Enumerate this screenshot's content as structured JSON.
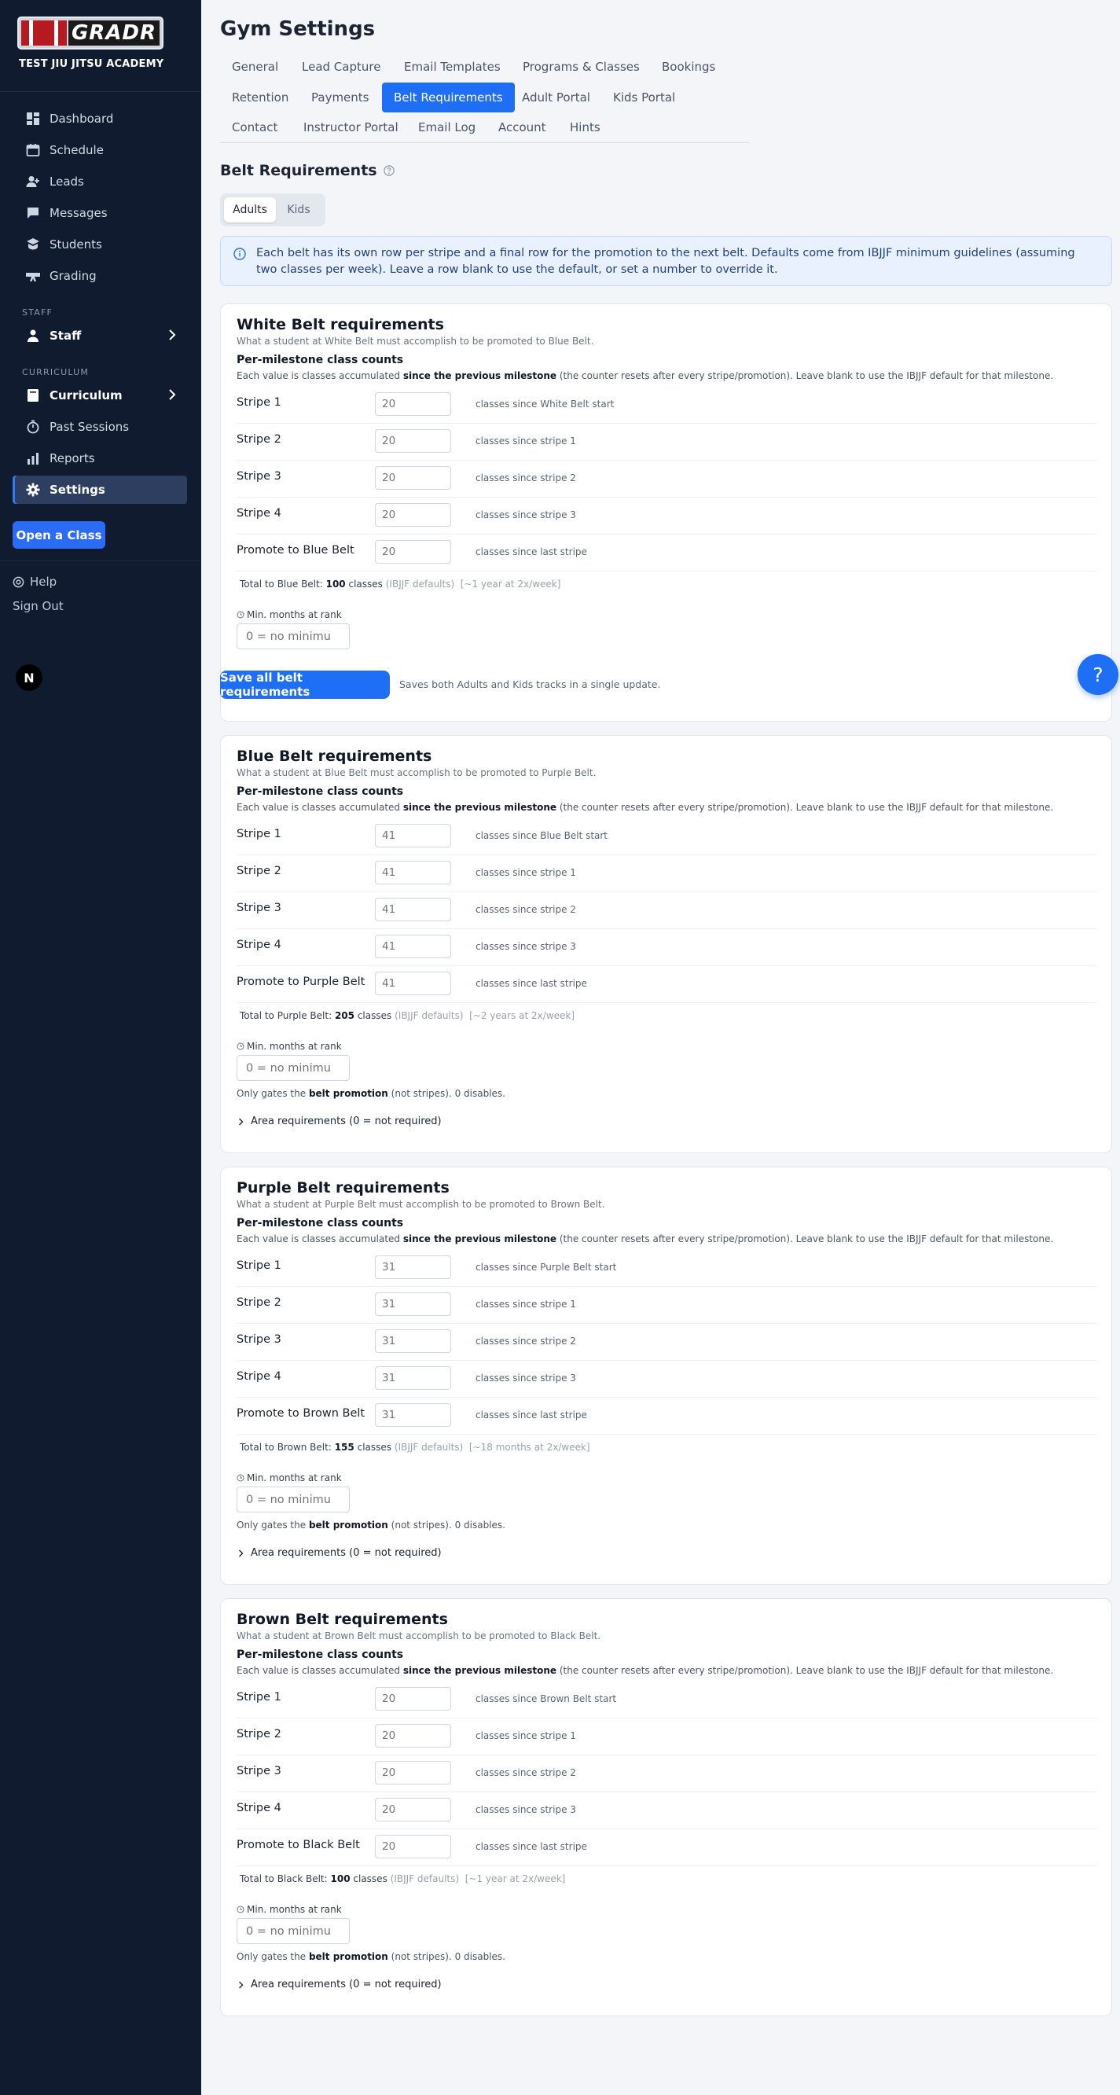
{
  "sidebar": {
    "logo_text": "GRADR",
    "academy": "TEST JIU JITSU ACADEMY",
    "nav": [
      {
        "label": "Dashboard",
        "icon": "dashboard-icon"
      },
      {
        "label": "Schedule",
        "icon": "calendar-icon"
      },
      {
        "label": "Leads",
        "icon": "user-plus-icon"
      },
      {
        "label": "Messages",
        "icon": "chat-icon"
      },
      {
        "label": "Students",
        "icon": "users-icon"
      },
      {
        "label": "Grading",
        "icon": "belt-icon"
      }
    ],
    "staff_section": "STAFF",
    "staff_item": "Staff",
    "curriculum_section": "CURRICULUM",
    "curriculum_nav": [
      {
        "label": "Curriculum",
        "icon": "book-icon"
      },
      {
        "label": "Past Sessions",
        "icon": "stopwatch-icon"
      },
      {
        "label": "Reports",
        "icon": "bar-chart-icon"
      },
      {
        "label": "Settings",
        "icon": "gear-icon"
      }
    ],
    "open_class": "Open a Class",
    "help": "Help",
    "sign_out": "Sign Out",
    "avatar": "N"
  },
  "header": {
    "title": "Gym Settings",
    "tabs": [
      "General",
      "Lead Capture",
      "Email Templates",
      "Programs & Classes",
      "Bookings",
      "Retention",
      "Payments",
      "Belt Requirements",
      "Adult Portal",
      "Kids Portal",
      "Contact",
      "Instructor Portal",
      "Email Log",
      "Account",
      "Hints"
    ],
    "active_tab": "Belt Requirements"
  },
  "section": {
    "title": "Belt Requirements",
    "segments": [
      "Adults",
      "Kids"
    ],
    "active_segment": "Adults",
    "info": "Each belt has its own row per stripe and a final row for the promotion to the next belt. Defaults come from IBJJF minimum guidelines (assuming two classes per week). Leave a row blank to use the default, or set a number to override it."
  },
  "common": {
    "pm_title": "Per-milestone class counts",
    "pm_desc_pre": "Each value is classes accumulated ",
    "pm_desc_bold": "since the previous milestone",
    "pm_desc_post": " (the counter resets after every stripe/promotion). Leave blank to use the IBJJF default for that milestone.",
    "stripe_labels": [
      "Stripe 1",
      "Stripe 2",
      "Stripe 3",
      "Stripe 4"
    ],
    "stripe_hints": [
      "classes since stripe 1",
      "classes since stripe 2",
      "classes since stripe 3"
    ],
    "last_hint": "classes since last stripe",
    "min_months_label": "Min. months at rank",
    "min_months_placeholder": "0 = no minimu",
    "gates_pre": "Only gates the ",
    "gates_bold": "belt promotion",
    "gates_post": " (not stripes). 0 disables.",
    "area_label": "Area requirements (0 = not required)",
    "classes_word": "classes",
    "ibjjf_defaults": "(IBJJF defaults)"
  },
  "belts": [
    {
      "title": "White Belt requirements",
      "sub": "What a student at White Belt must accomplish to be promoted to Blue Belt.",
      "first_hint": "classes since White Belt start",
      "promote_label": "Promote to Blue Belt",
      "value": "20",
      "total_label": "Total to Blue Belt: ",
      "total_value": "100",
      "estimate": "[~1 year at 2x/week]"
    },
    {
      "title": "Blue Belt requirements",
      "sub": "What a student at Blue Belt must accomplish to be promoted to Purple Belt.",
      "first_hint": "classes since Blue Belt start",
      "promote_label": "Promote to Purple Belt",
      "value": "41",
      "total_label": "Total to Purple Belt: ",
      "total_value": "205",
      "estimate": "[~2 years at 2x/week]"
    },
    {
      "title": "Purple Belt requirements",
      "sub": "What a student at Purple Belt must accomplish to be promoted to Brown Belt.",
      "first_hint": "classes since Purple Belt start",
      "promote_label": "Promote to Brown Belt",
      "value": "31",
      "total_label": "Total to Brown Belt: ",
      "total_value": "155",
      "estimate": "[~18 months at 2x/week]"
    },
    {
      "title": "Brown Belt requirements",
      "sub": "What a student at Brown Belt must accomplish to be promoted to Black Belt.",
      "first_hint": "classes since Brown Belt start",
      "promote_label": "Promote to Black Belt",
      "value": "20",
      "total_label": "Total to Black Belt: ",
      "total_value": "100",
      "estimate": "[~1 year at 2x/week]"
    }
  ],
  "save": {
    "button": "Save all belt requirements",
    "note": "Saves both Adults and Kids tracks in a single update."
  },
  "fab": "?",
  "colors": {
    "sidebar_bg": "#101b30",
    "accent": "#1f6ef6",
    "active_nav": "#2d3e60"
  }
}
